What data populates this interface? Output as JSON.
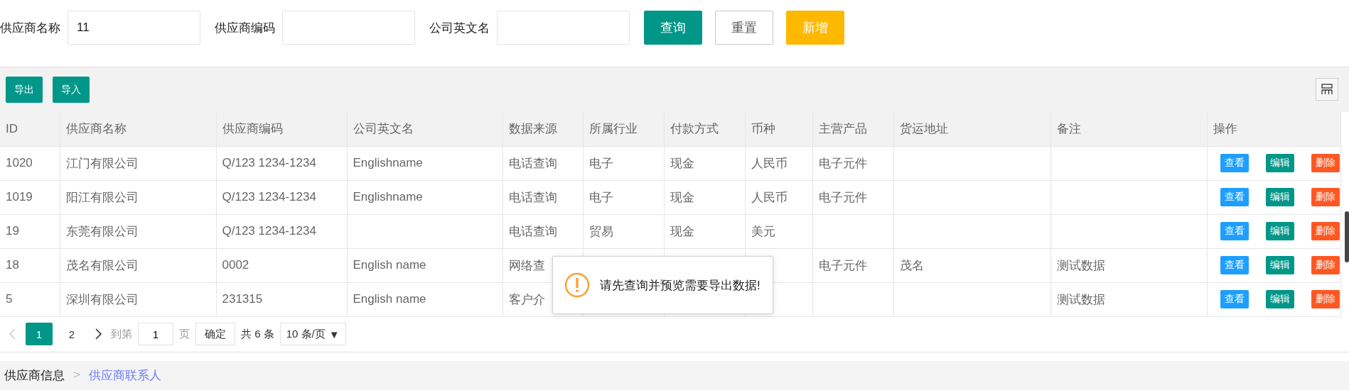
{
  "search": {
    "fields": [
      {
        "label": "供应商名称",
        "value": "11"
      },
      {
        "label": "供应商编码"
      },
      {
        "label": "公司英文名"
      }
    ],
    "buttons": [
      {
        "label": "查询",
        "kind": "primary"
      },
      {
        "label": "重置",
        "kind": "plain"
      },
      {
        "label": "新增",
        "kind": "warn"
      }
    ]
  },
  "toolbar": {
    "buttons": [
      "导出",
      "导入"
    ]
  },
  "table": {
    "columns": [
      "ID",
      "供应商名称",
      "供应商编码",
      "公司英文名",
      "数据来源",
      "所属行业",
      "付款方式",
      "币种",
      "主营产品",
      "货运地址",
      "备注",
      "操作"
    ],
    "rows": [
      {
        "cells": [
          "1020",
          "江门有限公司",
          "Q/123 1234-1234",
          "Englishname",
          "电话查询",
          "电子",
          "现金",
          "人民币",
          "电子元件",
          null,
          null
        ],
        "actions": [
          "查看",
          "编辑",
          "删除"
        ]
      },
      {
        "cells": [
          "1019",
          "阳江有限公司",
          "Q/123 1234-1234",
          "Englishname",
          "电话查询",
          "电子",
          "现金",
          "人民币",
          "电子元件",
          null,
          null
        ],
        "actions": [
          "查看",
          "编辑",
          "删除"
        ]
      },
      {
        "cells": [
          "19",
          "东莞有限公司",
          "Q/123 1234-1234",
          null,
          "电话查询",
          "贸易",
          "现金",
          "美元",
          null,
          null,
          null
        ],
        "actions": [
          "查看",
          "编辑",
          "删除"
        ]
      },
      {
        "cells": [
          "18",
          "茂名有限公司",
          "0002",
          "English name",
          "网络查",
          null,
          null,
          null,
          "电子元件",
          "茂名",
          "测试数据"
        ],
        "actions": [
          "查看",
          "编辑",
          "删除"
        ]
      },
      {
        "cells": [
          "5",
          "深圳有限公司",
          "231315",
          "English name",
          "客户介",
          null,
          null,
          null,
          null,
          null,
          "测试数据"
        ],
        "actions": [
          "查看",
          "编辑",
          "删除"
        ]
      }
    ]
  },
  "pagination": {
    "pages": [
      {
        "label": "1",
        "selected": true
      },
      {
        "label": "2",
        "selected": false
      }
    ],
    "goto_label": "到第",
    "goto_value": "1",
    "page_unit": "页",
    "confirm": "确定",
    "total": "共 6 条",
    "page_size": "10 条/页",
    "caret": "▼"
  },
  "toast": {
    "message": "请先查询并预览需要导出数据!"
  },
  "breadcrumb": [
    {
      "label": "供应商信息",
      "selected": false
    },
    {
      "label": "供应商联系人",
      "selected": true
    }
  ],
  "breadcrumb_separator": ">"
}
